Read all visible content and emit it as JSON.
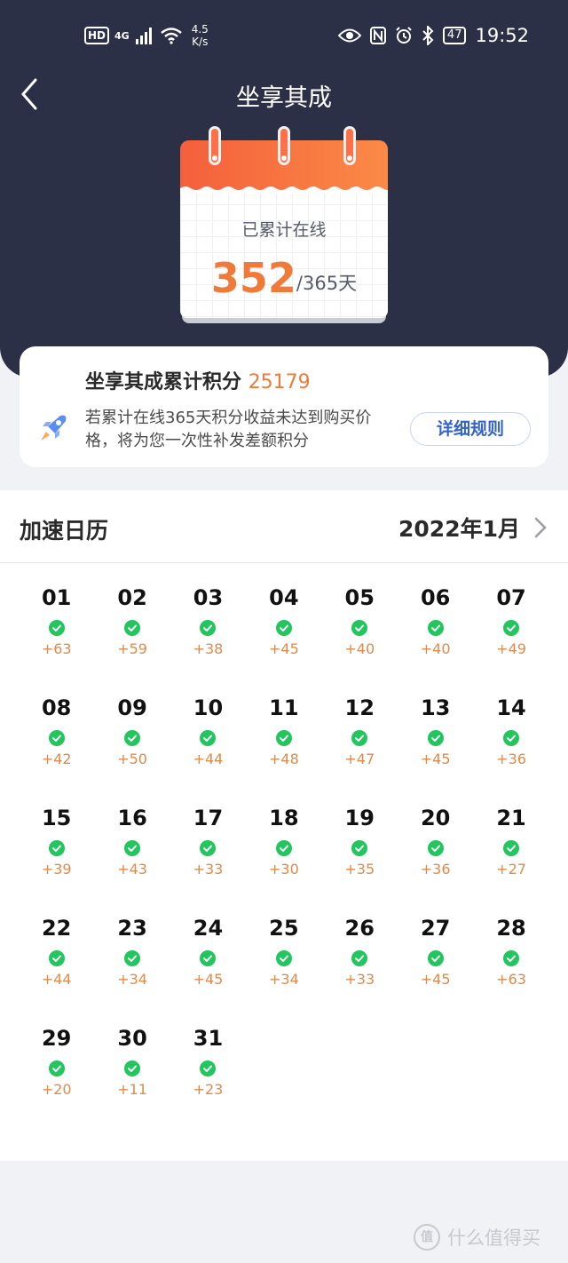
{
  "status_bar": {
    "hd": "HD",
    "network": "4G",
    "speed_value": "4.5",
    "speed_unit": "K/s",
    "battery": "47",
    "time": "19:52"
  },
  "header": {
    "title": "坐享其成"
  },
  "calendar_card": {
    "label": "已累计在线",
    "days_online": "352",
    "days_total": "/365天"
  },
  "points_card": {
    "title": "坐享其成累计积分",
    "points": "25179",
    "description": "若累计在线365天积分收益未达到购买价格，将为您一次性补发差额积分",
    "rules_button": "详细规则"
  },
  "accel_calendar": {
    "title": "加速日历",
    "month": "2022年1月",
    "days": [
      {
        "day": "01",
        "points": "+63"
      },
      {
        "day": "02",
        "points": "+59"
      },
      {
        "day": "03",
        "points": "+38"
      },
      {
        "day": "04",
        "points": "+45"
      },
      {
        "day": "05",
        "points": "+40"
      },
      {
        "day": "06",
        "points": "+40"
      },
      {
        "day": "07",
        "points": "+49"
      },
      {
        "day": "08",
        "points": "+42"
      },
      {
        "day": "09",
        "points": "+50"
      },
      {
        "day": "10",
        "points": "+44"
      },
      {
        "day": "11",
        "points": "+48"
      },
      {
        "day": "12",
        "points": "+47"
      },
      {
        "day": "13",
        "points": "+45"
      },
      {
        "day": "14",
        "points": "+36"
      },
      {
        "day": "15",
        "points": "+39"
      },
      {
        "day": "16",
        "points": "+43"
      },
      {
        "day": "17",
        "points": "+33"
      },
      {
        "day": "18",
        "points": "+30"
      },
      {
        "day": "19",
        "points": "+35"
      },
      {
        "day": "20",
        "points": "+36"
      },
      {
        "day": "21",
        "points": "+27"
      },
      {
        "day": "22",
        "points": "+44"
      },
      {
        "day": "23",
        "points": "+34"
      },
      {
        "day": "24",
        "points": "+45"
      },
      {
        "day": "25",
        "points": "+34"
      },
      {
        "day": "26",
        "points": "+33"
      },
      {
        "day": "27",
        "points": "+45"
      },
      {
        "day": "28",
        "points": "+63"
      },
      {
        "day": "29",
        "points": "+20"
      },
      {
        "day": "30",
        "points": "+11"
      },
      {
        "day": "31",
        "points": "+23"
      }
    ]
  },
  "watermark": {
    "logo": "值",
    "text": "什么值得买"
  },
  "colors": {
    "header_bg": "#2c3047",
    "accent_orange": "#f07a3a",
    "check_green": "#22c55e",
    "link_blue": "#3564c9"
  }
}
